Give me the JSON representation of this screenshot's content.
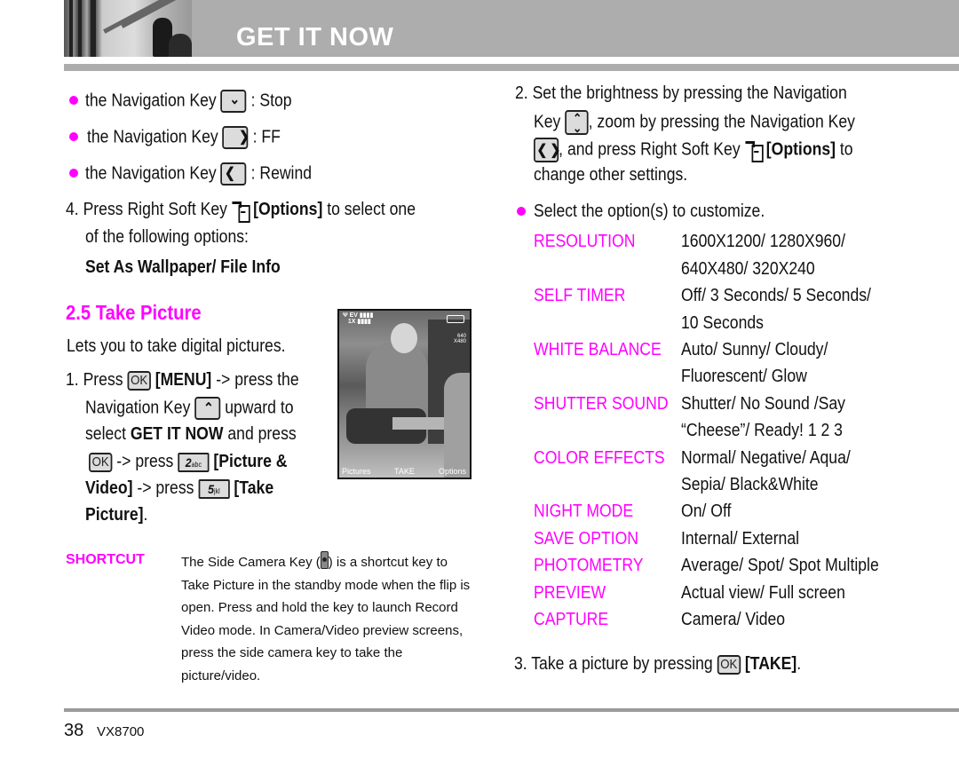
{
  "header": {
    "title": "GET IT NOW"
  },
  "left_column": {
    "nav_bullets": [
      {
        "prefix": "the Navigation Key",
        "key_icon": "nav-down-icon",
        "action": ": Stop"
      },
      {
        "prefix": "the Navigation Key",
        "key_icon": "nav-right-icon",
        "action": ": FF"
      },
      {
        "prefix": "the Navigation Key",
        "key_icon": "nav-left-icon",
        "action": ": Rewind"
      }
    ],
    "step4": {
      "line1_a": "4. Press Right Soft Key",
      "options_label": "[Options]",
      "line1_b": "to select one",
      "line2": "of the following options:",
      "choices": "Set As Wallpaper/ File Info"
    },
    "section": {
      "title": "2.5 Take Picture",
      "intro": "Lets you to take digital pictures."
    },
    "step1": {
      "l1_a": "1. Press",
      "l1_ok": "OK",
      "l1_b": "[MENU]",
      "l1_c": "-> press the",
      "l2_a": "Navigation Key",
      "l2_b": "upward to",
      "l3_a": "select",
      "l3_b": "GET IT NOW",
      "l3_c": "and press",
      "l4_ok": "OK",
      "l4_a": "-> press",
      "l4_key_num": "2",
      "l4_key_letters": "abc",
      "l4_b": "[Picture &",
      "l5_a": "Video]",
      "l5_b": "-> press",
      "l5_key_num": "5",
      "l5_key_letters": "jkl",
      "l5_c": "[Take",
      "l6_a": "Picture]",
      "l6_b": "."
    },
    "phone_screen": {
      "status_top": "EV",
      "status_bottom": "1X",
      "resolution_top": "640",
      "resolution_bottom": "X480",
      "softkey_left": "Pictures",
      "softkey_center": "TAKE",
      "softkey_right": "Options"
    },
    "shortcut": {
      "label": "SHORTCUT",
      "text_before_icon": "The Side Camera Key (",
      "text_after_icon": ") is a shortcut key to Take Picture in the standby mode when the flip is open. Press and hold the key to launch Record Video mode. In Camera/Video preview screens, press the side camera key to take the picture/video."
    }
  },
  "right_column": {
    "step2": {
      "l1": "2. Set the brightness by pressing the Navigation",
      "l2_a": "Key",
      "l2_b": ", zoom by pressing the Navigation Key",
      "l3_a": ", and press Right Soft Key",
      "l3_b": "[Options]",
      "l3_c": "to",
      "l4": "change other settings."
    },
    "bullet_select": "Select the option(s) to customize.",
    "options": [
      {
        "label": "RESOLUTION",
        "values": [
          "1600X1200/ 1280X960/",
          "640X480/ 320X240"
        ]
      },
      {
        "label": "SELF TIMER",
        "values": [
          "Off/ 3 Seconds/ 5 Seconds/",
          "10 Seconds"
        ]
      },
      {
        "label": "WHITE BALANCE",
        "values": [
          "Auto/ Sunny/ Cloudy/",
          "Fluorescent/ Glow"
        ]
      },
      {
        "label": "SHUTTER SOUND",
        "values": [
          "Shutter/ No Sound /Say",
          "“Cheese”/ Ready! 1 2 3"
        ]
      },
      {
        "label": "COLOR EFFECTS",
        "values": [
          "Normal/ Negative/ Aqua/",
          "Sepia/ Black&White"
        ]
      },
      {
        "label": "NIGHT MODE",
        "values": [
          "On/ Off"
        ]
      },
      {
        "label": "SAVE OPTION",
        "values": [
          "Internal/ External"
        ]
      },
      {
        "label": "PHOTOMETRY",
        "values": [
          "Average/ Spot/ Spot Multiple"
        ]
      },
      {
        "label": "PREVIEW",
        "values": [
          "Actual view/ Full screen"
        ]
      },
      {
        "label": "CAPTURE",
        "values": [
          "Camera/ Video"
        ]
      }
    ],
    "step3": {
      "a": "3. Take a picture by pressing",
      "ok": "OK",
      "b": "[TAKE]",
      "c": "."
    }
  },
  "footer": {
    "page_number": "38",
    "model": "VX8700"
  },
  "colors": {
    "accent": "#ff00ff",
    "header_gray": "#adadad",
    "text": "#111111"
  }
}
